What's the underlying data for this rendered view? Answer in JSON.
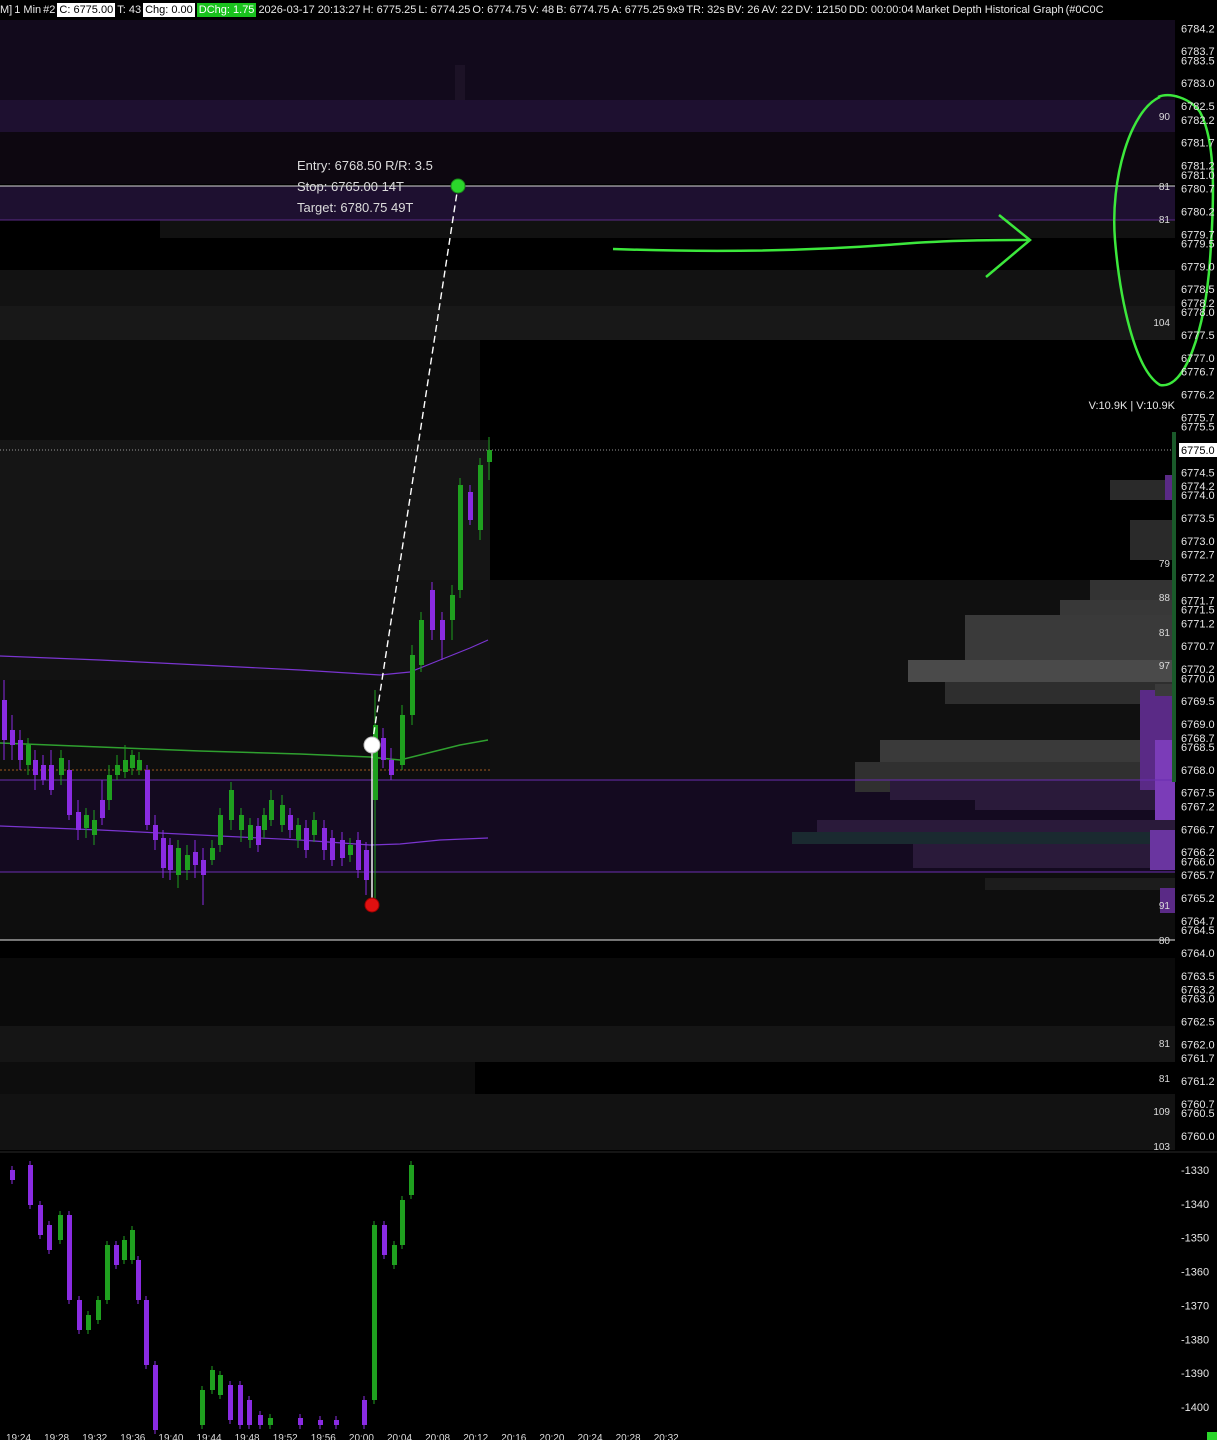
{
  "header": {
    "window_prefix": "M]",
    "timeframe": "1 Min",
    "chart_num": "#2",
    "close": "C: 6775.00",
    "trades": "T: 43",
    "change": "Chg: 0.00",
    "daily_change": "DChg: 1.75",
    "datetime": "2026-03-17 20:13:27",
    "high": "H: 6775.25",
    "low": "L: 6774.25",
    "open": "O: 6774.75",
    "volume": "V: 48",
    "bid": "B: 6774.75",
    "ask": "A: 6775.25",
    "bar_size": "9x9",
    "time_remaining": "TR: 32s",
    "bid_volume": "BV: 26",
    "ask_volume": "AV: 22",
    "delta_volume": "DV: 12150",
    "duration": "DD: 00:00:04",
    "study_name": "Market Depth Historical Graph",
    "color_code": "(#0C0C"
  },
  "trade_box": {
    "entry": "Entry: 6768.50  R/R: 3.5",
    "stop": "Stop: 6765.00  14T",
    "target": "Target: 6780.75  49T"
  },
  "volume_label": "V:10.9K | V:10.9K",
  "current_price_label": "6775.0",
  "colors": {
    "up": "#1fa01f",
    "down": "#8a2be2",
    "accent_green": "#2bd62b",
    "depth_purple": "#5a2a86",
    "background": "#000000"
  },
  "price_axis": {
    "labels": [
      "6784.2",
      "6783.7",
      "6783.5",
      "6783.0",
      "6782.5",
      "6782.2",
      "6781.7",
      "6781.2",
      "6781.0",
      "6780.7",
      "6780.2",
      "6779.7",
      "6779.5",
      "6779.0",
      "6778.5",
      "6778.2",
      "6778.0",
      "6777.5",
      "6777.0",
      "6776.7",
      "6776.2",
      "6775.7",
      "6775.5",
      "6774.5",
      "6774.2",
      "6774.0",
      "6773.5",
      "6773.0",
      "6772.7",
      "6772.2",
      "6771.7",
      "6771.5",
      "6771.2",
      "6770.7",
      "6770.2",
      "6770.0",
      "6769.5",
      "6769.0",
      "6768.7",
      "6768.5",
      "6768.0",
      "6767.5",
      "6767.2",
      "6766.7",
      "6766.2",
      "6766.0",
      "6765.7",
      "6765.2",
      "6764.7",
      "6764.5",
      "6764.0",
      "6763.5",
      "6763.2",
      "6763.0",
      "6762.5",
      "6762.0",
      "6761.7",
      "6761.2",
      "6760.7",
      "6760.5",
      "6760.0"
    ]
  },
  "depth_labels": [
    "90",
    "81",
    "81",
    "104",
    "79",
    "88",
    "81",
    "97",
    "91",
    "80",
    "81",
    "81",
    "109",
    "103"
  ],
  "delta_axis": {
    "labels": [
      "-1330",
      "-1340",
      "-1350",
      "-1360",
      "-1370",
      "-1380",
      "-1390",
      "-1400"
    ]
  },
  "time_axis": {
    "labels": [
      "19:24",
      "19:28",
      "19:32",
      "19:36",
      "19:40",
      "19:44",
      "19:48",
      "19:52",
      "19:56",
      "20:00",
      "20:04",
      "20:08",
      "20:12",
      "20:16",
      "20:20",
      "20:24",
      "20:28",
      "20:32"
    ]
  },
  "chart_data": {
    "type": "candlestick",
    "price_ylim": [
      6760.0,
      6784.25
    ],
    "entry": 6768.5,
    "stop": 6765.0,
    "target": 6780.75,
    "current": 6775.0,
    "delta_ylim": [
      -1403,
      -1325
    ],
    "grid": false
  }
}
